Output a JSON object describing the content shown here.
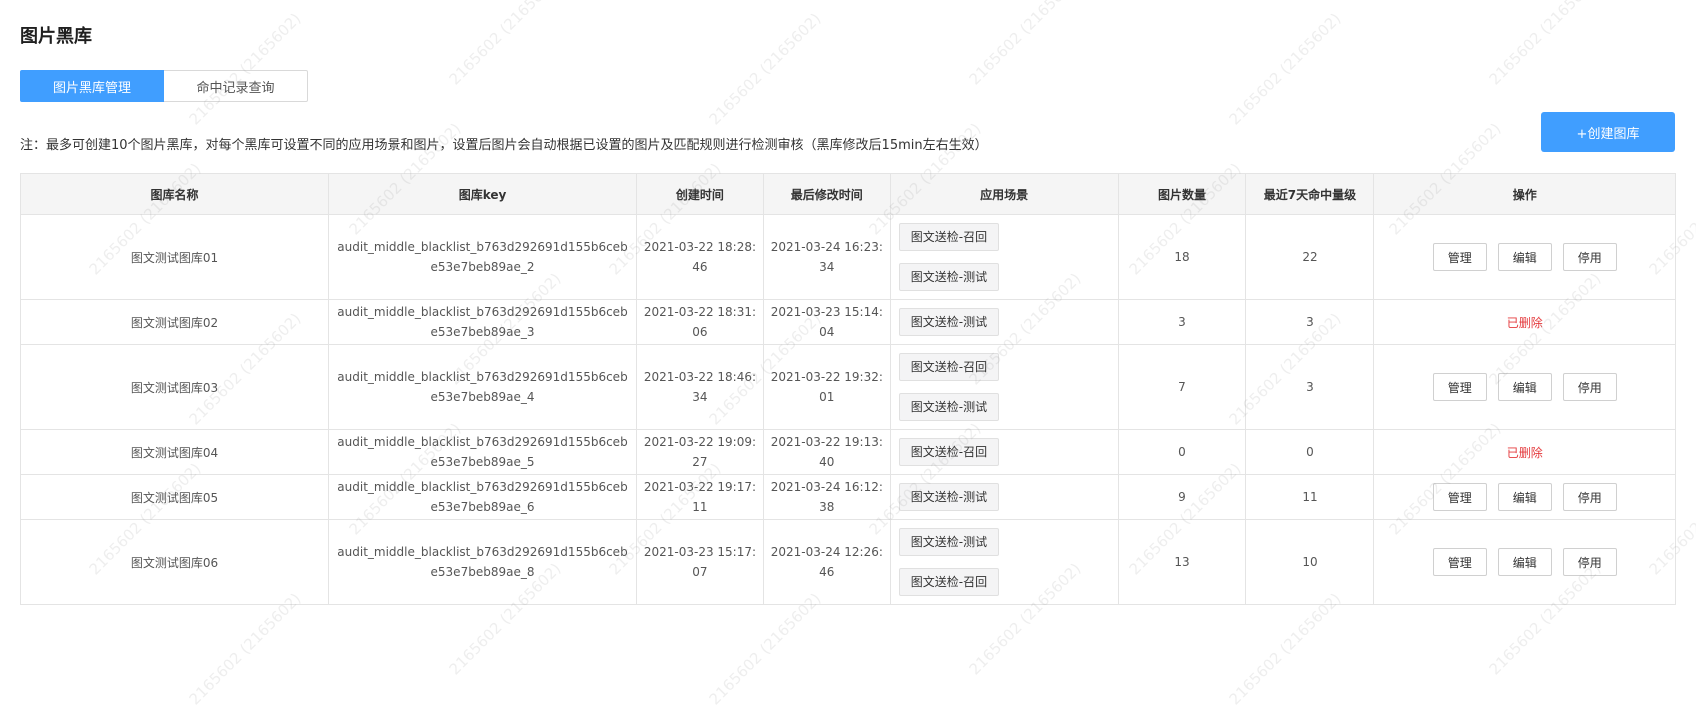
{
  "page": {
    "title": "图片黑库",
    "note": "注：最多可创建10个图片黑库，对每个黑库可设置不同的应用场景和图片，设置后图片会自动根据已设置的图片及匹配规则进行检测审核（黑库修改后15min左右生效）",
    "watermark": "2165602 (2165602)"
  },
  "tabs": [
    {
      "label": "图片黑库管理",
      "active": true
    },
    {
      "label": "命中记录查询",
      "active": false
    }
  ],
  "create_button": "+创建图库",
  "table": {
    "columns": [
      "图库名称",
      "图库key",
      "创建时间",
      "最后修改时间",
      "应用场景",
      "图片数量",
      "最近7天命中量级",
      "操作"
    ],
    "action_labels": {
      "manage": "管理",
      "edit": "编辑",
      "disable": "停用"
    },
    "rows": [
      {
        "name": "图文测试图库01",
        "key": "audit_middle_blacklist_b763d292691d155b6cebe53e7beb89ae_2",
        "created": "2021-03-22 18:28:46",
        "modified": "2021-03-24 16:23:34",
        "scenes": [
          "图文送检-召回",
          "图文送检-测试"
        ],
        "count": "18",
        "hits": "22",
        "deleted": false
      },
      {
        "name": "图文测试图库02",
        "key": "audit_middle_blacklist_b763d292691d155b6cebe53e7beb89ae_3",
        "created": "2021-03-22 18:31:06",
        "modified": "2021-03-23 15:14:04",
        "scenes": [
          "图文送检-测试"
        ],
        "count": "3",
        "hits": "3",
        "deleted": true,
        "status": "已删除"
      },
      {
        "name": "图文测试图库03",
        "key": "audit_middle_blacklist_b763d292691d155b6cebe53e7beb89ae_4",
        "created": "2021-03-22 18:46:34",
        "modified": "2021-03-22 19:32:01",
        "scenes": [
          "图文送检-召回",
          "图文送检-测试"
        ],
        "count": "7",
        "hits": "3",
        "deleted": false
      },
      {
        "name": "图文测试图库04",
        "key": "audit_middle_blacklist_b763d292691d155b6cebe53e7beb89ae_5",
        "created": "2021-03-22 19:09:27",
        "modified": "2021-03-22 19:13:40",
        "scenes": [
          "图文送检-召回"
        ],
        "count": "0",
        "hits": "0",
        "deleted": true,
        "status": "已删除"
      },
      {
        "name": "图文测试图库05",
        "key": "audit_middle_blacklist_b763d292691d155b6cebe53e7beb89ae_6",
        "created": "2021-03-22 19:17:11",
        "modified": "2021-03-24 16:12:38",
        "scenes": [
          "图文送检-测试"
        ],
        "count": "9",
        "hits": "11",
        "deleted": false
      },
      {
        "name": "图文测试图库06",
        "key": "audit_middle_blacklist_b763d292691d155b6cebe53e7beb89ae_8",
        "created": "2021-03-23 15:17:07",
        "modified": "2021-03-24 12:26:46",
        "scenes": [
          "图文送检-测试",
          "图文送检-召回"
        ],
        "count": "13",
        "hits": "10",
        "deleted": false
      }
    ]
  }
}
